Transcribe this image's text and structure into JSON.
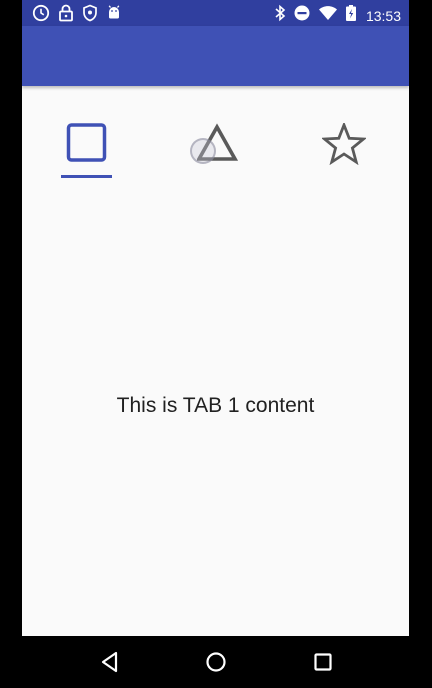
{
  "status_bar": {
    "time": "13:53",
    "left_icons": [
      "clock-icon",
      "lock-icon",
      "shield-icon",
      "android-icon"
    ],
    "right_icons": [
      "bluetooth-icon",
      "do-not-disturb-icon",
      "wifi-icon",
      "battery-icon"
    ]
  },
  "colors": {
    "primary": "#3f51b5",
    "primary_dark": "#303f9f",
    "tab_inactive": "#5a5a5a"
  },
  "tabs": [
    {
      "icon": "square-icon",
      "selected": true
    },
    {
      "icon": "triangle-icon",
      "selected": false
    },
    {
      "icon": "star-icon",
      "selected": false
    }
  ],
  "content": {
    "message": "This is TAB 1 content"
  },
  "nav_bar": {
    "buttons": [
      "back-icon",
      "home-icon",
      "recents-icon"
    ]
  }
}
